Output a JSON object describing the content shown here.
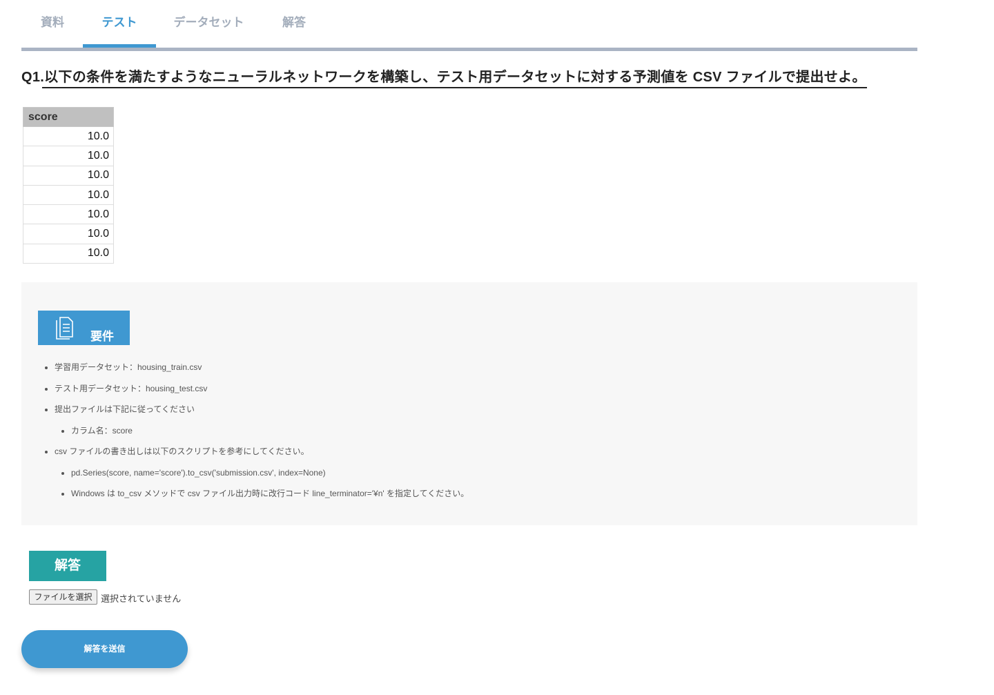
{
  "tabs": [
    {
      "label": "資料"
    },
    {
      "label": "テスト",
      "active": true
    },
    {
      "label": "データセット"
    },
    {
      "label": "解答"
    }
  ],
  "question": {
    "title": "Q1.以下の条件を満たすようなニューラルネットワークを構築し、テスト用データセットに対する予測値を CSV ファイルで提出せよ。"
  },
  "table": {
    "header": "score",
    "rows": [
      "10.0",
      "10.0",
      "10.0",
      "10.0",
      "10.0",
      "10.0",
      "10.0"
    ]
  },
  "requirements": {
    "heading": "要件",
    "icon": "document-icon",
    "items": [
      "学習用データセット：housing_train.csv",
      "テスト用データセット：housing_test.csv",
      "提出ファイルは下記に従ってください",
      "カラム名：score",
      "csv ファイルの書き出しは以下のスクリプトを参考にしてください。",
      "pd.Series(score, name='score').to_csv('submission.csv', index=None)",
      "Windows は to_csv メソッドで csv ファイル出力時に改行コード line_terminator='¥n' を指定してください。"
    ]
  },
  "answer": {
    "heading": "解答",
    "file_button": "ファイルを選択",
    "file_status": "選択されていません",
    "submit": "解答を送信"
  },
  "colors": {
    "accent": "#3f98d1",
    "answer_heading": "#26a3a3",
    "panel_bg": "#f7f7f7"
  }
}
